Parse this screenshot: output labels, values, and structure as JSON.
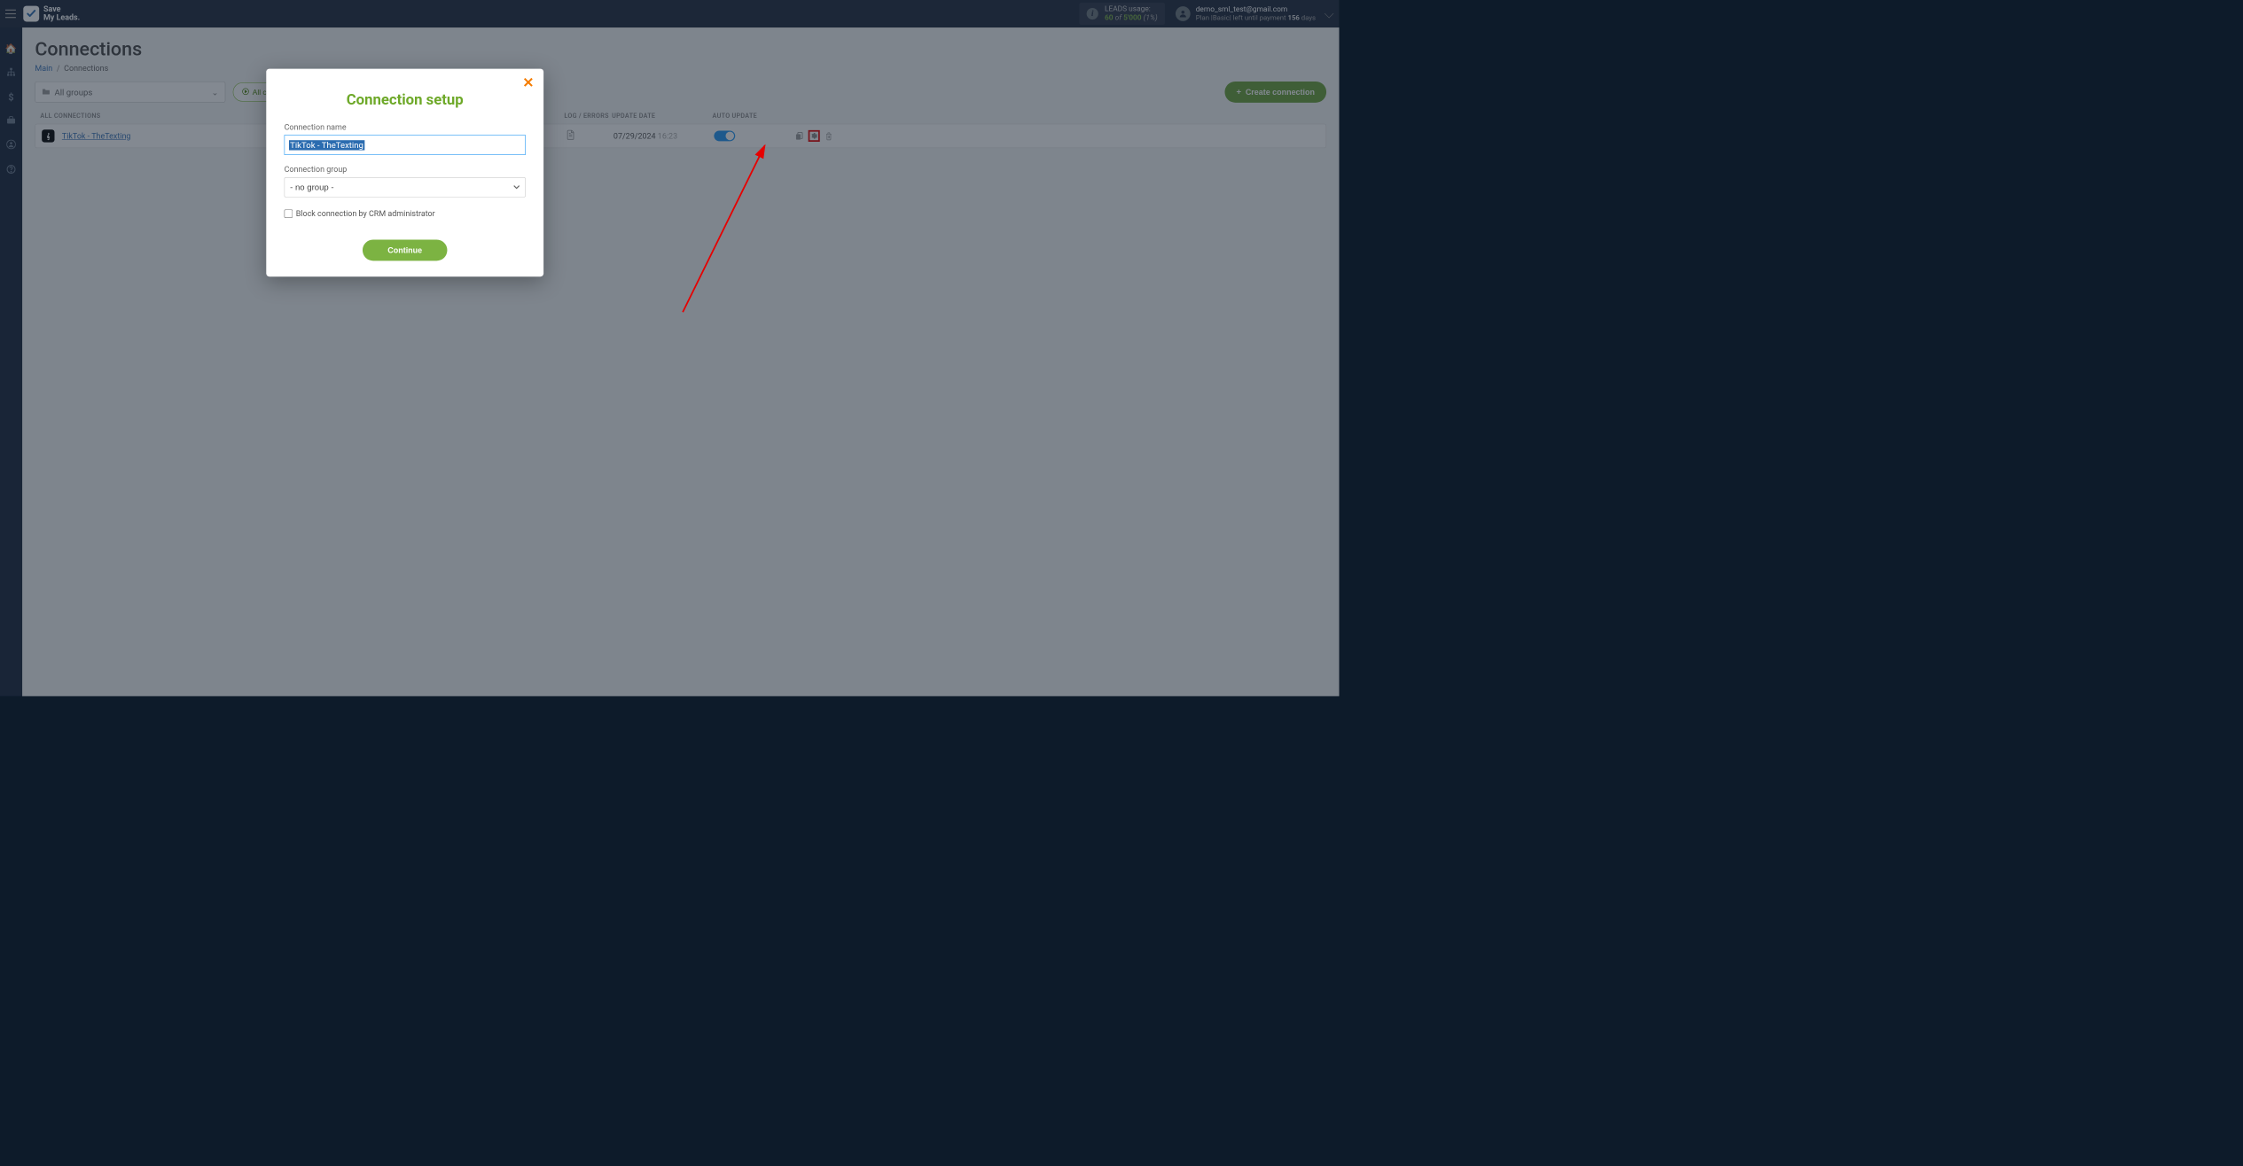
{
  "brand": {
    "line1": "Save",
    "line2": "My Leads."
  },
  "usage": {
    "label": "LEADS usage:",
    "current": "60",
    "of": "of",
    "limit": "5'000",
    "pct": "(1%)"
  },
  "user": {
    "email": "demo_sml_test@gmail.com",
    "plan_prefix": "Plan |Basic| left until payment ",
    "days": "156",
    "days_suffix": " days"
  },
  "page": {
    "title": "Connections"
  },
  "breadcrumb": {
    "main": "Main",
    "current": "Connections"
  },
  "filters": {
    "groups": "All groups",
    "all_connections": "All connections"
  },
  "create": "Create connection",
  "columns": {
    "all": "ALL CONNECTIONS",
    "log": "LOG / ERRORS",
    "date": "UPDATE DATE",
    "auto": "AUTO UPDATE"
  },
  "row": {
    "name": "TikTok - TheTexting",
    "date": "07/29/2024",
    "time": "16:23"
  },
  "modal": {
    "title": "Connection setup",
    "name_label": "Connection name",
    "name_value": "TikTok - TheTexting",
    "group_label": "Connection group",
    "group_option": "- no group -",
    "block": "Block connection by CRM administrator",
    "continue": "Continue"
  }
}
